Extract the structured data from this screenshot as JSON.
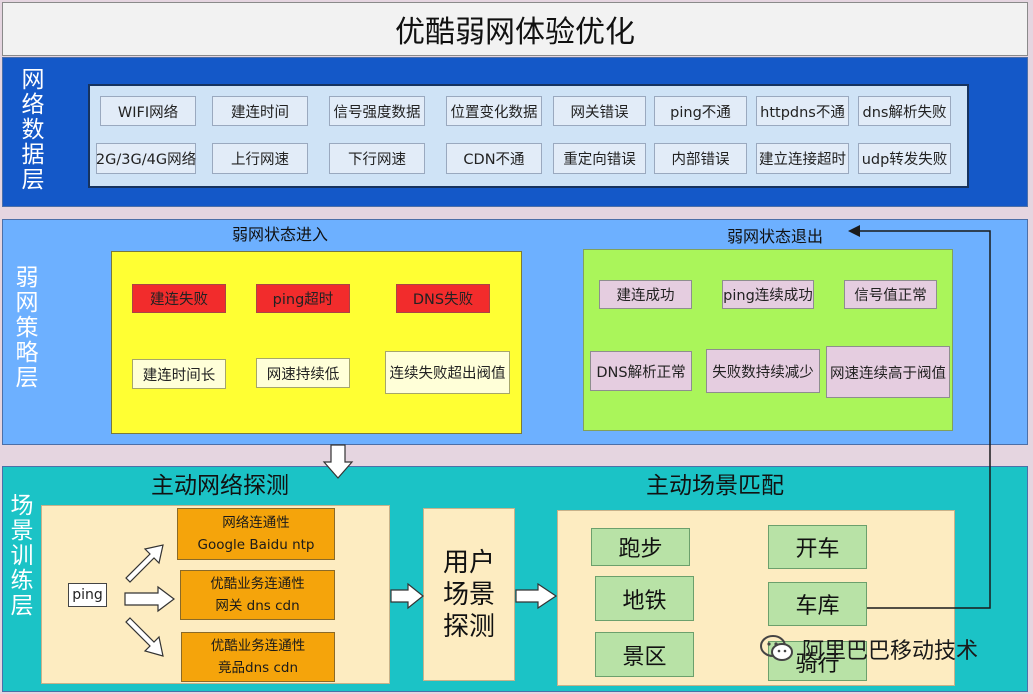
{
  "title": "优酷弱网体验优化",
  "layer1": {
    "label": [
      "网",
      "络",
      "数",
      "据",
      "层"
    ],
    "items": [
      "WIFI网络",
      "建连时间",
      "信号强度数据",
      "位置变化数据",
      "网关错误",
      "ping不通",
      "httpdns不通",
      "dns解析失败",
      "2G/3G/4G网络",
      "上行网速",
      "下行网速",
      "CDN不通",
      "重定向错误",
      "内部错误",
      "建立连接超时",
      "udp转发失败"
    ]
  },
  "layer2": {
    "label": [
      "弱",
      "网",
      "策",
      "略",
      "层"
    ],
    "enter_title": "弱网状态进入",
    "exit_title": "弱网状态退出",
    "enter_items": [
      "建连失败",
      "ping超时",
      "DNS失败",
      "建连时间长",
      "网速持续低",
      "连续失败超出阀值"
    ],
    "exit_items": [
      "建连成功",
      "ping连续成功",
      "信号值正常",
      "DNS解析正常",
      "失败数持续减少",
      "网速连续高于阀值"
    ]
  },
  "layer3": {
    "label": [
      "场",
      "景",
      "训",
      "练",
      "层"
    ],
    "probe_title": "主动网络探测",
    "match_title": "主动场景匹配",
    "ping": "ping",
    "probe_items": [
      {
        "line1": "网络连通性",
        "line2": "Google Baidu ntp"
      },
      {
        "line1": "优酷业务连通性",
        "line2": "网关 dns cdn"
      },
      {
        "line1": "优酷业务连通性",
        "line2": "竟品dns cdn"
      }
    ],
    "user_scene": [
      "用户",
      "场景",
      "探测"
    ],
    "scenes": [
      "跑步",
      "开车",
      "地铁",
      "车库",
      "景区",
      "骑行"
    ]
  },
  "watermark": "阿里巴巴移动技术",
  "colors": {
    "layer1": "#1458c8",
    "layer2": "#6db0ff",
    "layer3": "#1bc3c6",
    "enter_panel": "#ffff33",
    "exit_panel": "#aaf55a",
    "fail_box": "#f22c2c",
    "probe_box": "#f5a40b",
    "scene_box": "#b8e2a6"
  }
}
